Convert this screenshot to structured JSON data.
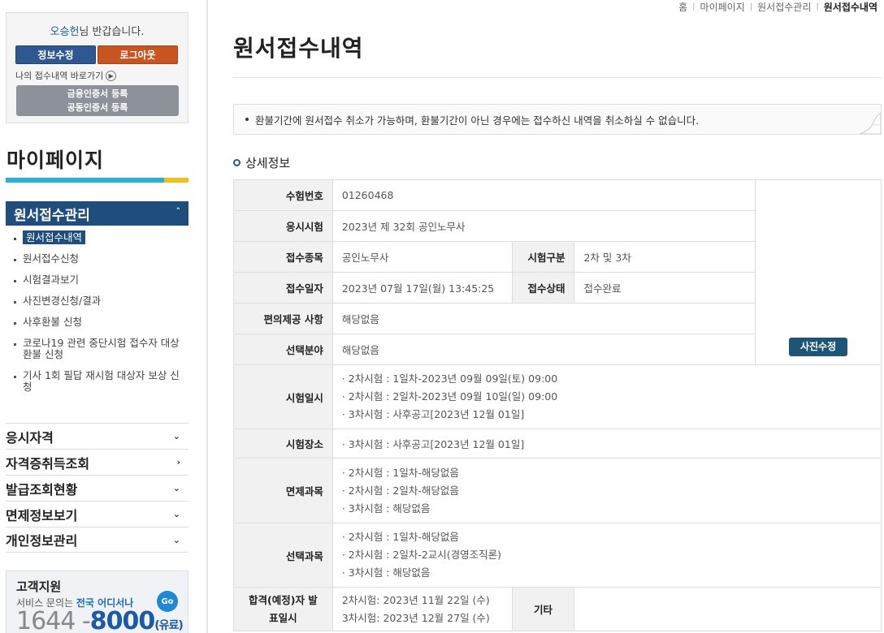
{
  "login": {
    "user_name": "오승헌",
    "greeting_suffix": "님 반갑습니다.",
    "edit_info_label": "정보수정",
    "logout_label": "로그아웃",
    "shortcut_label": "나의 접수내역 바로가기",
    "cert_line1": "금융인증서 등록",
    "cert_line2": "공동인증서 등록"
  },
  "sidebar": {
    "title": "마이페이지",
    "section_head": "원서접수관리",
    "submenu": [
      {
        "label": "원서접수내역",
        "active": true
      },
      {
        "label": "원서접수신청"
      },
      {
        "label": "시험결과보기"
      },
      {
        "label": "사진변경신청/결과"
      },
      {
        "label": "사후환불 신청"
      },
      {
        "label": "코로나19 관련 중단시험 접수자 대상 환불 신청"
      },
      {
        "label": "기사 1회 필답 재시험 대상자 보상 신청"
      }
    ],
    "mainmenu": [
      {
        "label": "응시자격",
        "arrow": "⌄"
      },
      {
        "label": "자격증취득조회",
        "arrow": "›"
      },
      {
        "label": "발급조회현황",
        "arrow": "⌄"
      },
      {
        "label": "면제정보보기",
        "arrow": "⌄"
      },
      {
        "label": "개인정보관리",
        "arrow": "⌄"
      }
    ]
  },
  "customer_support": {
    "title": "고객지원",
    "desc_prefix": "서비스 문의는",
    "desc_highlight": "전국 어디서나",
    "go_label": "Go",
    "phone_prefix": "1644 -",
    "phone_main": "8000",
    "phone_suffix": "(유료)"
  },
  "breadcrumb": [
    "홈",
    "마이페이지",
    "원서접수관리",
    "원서접수내역"
  ],
  "page_title": "원서접수내역",
  "notice": "환불기간에 원서접수 취소가 가능하며, 환불기간이 아닌 경우에는 접수하신 내역을 취소하실 수 없습니다.",
  "section_title": "상세정보",
  "detail": {
    "exam_no_label": "수험번호",
    "exam_no": "01260468",
    "exam_label": "응시시험",
    "exam": "2023년 제 32회 공인노무사",
    "category_label": "접수종목",
    "category": "공인노무사",
    "division_label": "시험구분",
    "division": "2차 및 3차",
    "date_label": "접수일자",
    "date": "2023년 07월 17일(월) 13:45:25",
    "status_label": "접수상태",
    "status": "접수완료",
    "convenience_label": "편의제공 사항",
    "convenience": "해당없음",
    "field_label": "선택분야",
    "field": "해당없음",
    "photo_button": "사진수정",
    "schedule_label": "시험일시",
    "schedule": [
      "· 2차시험 : 1일차-2023년 09월 09일(토) 09:00",
      "· 2차시험 : 2일차-2023년 09월 10일(일) 09:00",
      "· 3차시험 : 사후공고[2023년 12월 01일]"
    ],
    "place_label": "시험장소",
    "place": "· 3차시험 : 사후공고[2023년 12월 01일]",
    "exempt_label": "면제과목",
    "exempt": [
      "· 2차시험 : 1일차-해당없음",
      "· 2차시험 : 2일차-해당없음",
      "· 3차시험 : 해당없음"
    ],
    "elective_label": "선택과목",
    "elective": [
      "· 2차시험 : 1일차-해당없음",
      "· 2차시험 : 2일차-2교시(경영조직론)",
      "· 3차시험 : 해당없음"
    ],
    "announce_label_1": "합격(예정)자 발",
    "announce_label_2": "표일시",
    "announce": [
      "2차시험: 2023년 11월 22일 (수)",
      "3차시험: 2023년 12월 27일 (수)"
    ],
    "etc_label": "기타"
  }
}
